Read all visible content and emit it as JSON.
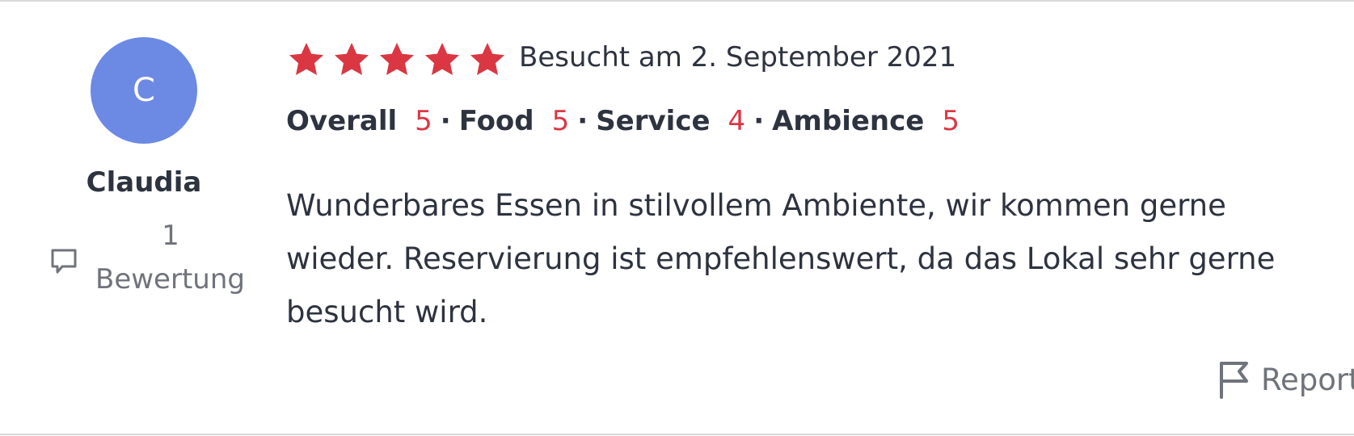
{
  "user": {
    "initial": "C",
    "name": "Claudia",
    "review_count": "1",
    "review_count_label": "Bewertung",
    "avatar_color": "#6c8ae4"
  },
  "review": {
    "star_rating": 5,
    "star_max": 5,
    "star_color": "#da3743",
    "visited": "Besucht am 2. September 2021",
    "ratings": {
      "overall_label": "Overall",
      "overall_value": "5",
      "food_label": "Food",
      "food_value": "5",
      "service_label": "Service",
      "service_value": "4",
      "ambience_label": "Ambience",
      "ambience_value": "5",
      "separator": "·"
    },
    "text": "Wunderbares Essen in stilvollem Ambiente, wir kommen gerne wieder. Reservierung ist empfehlenswert, da das Lokal sehr gerne besucht wird."
  },
  "actions": {
    "report_label": "Report",
    "report_icon": "flag-icon"
  },
  "icons": {
    "review_count_icon": "speech-bubble-icon",
    "star_icon": "star-icon"
  }
}
